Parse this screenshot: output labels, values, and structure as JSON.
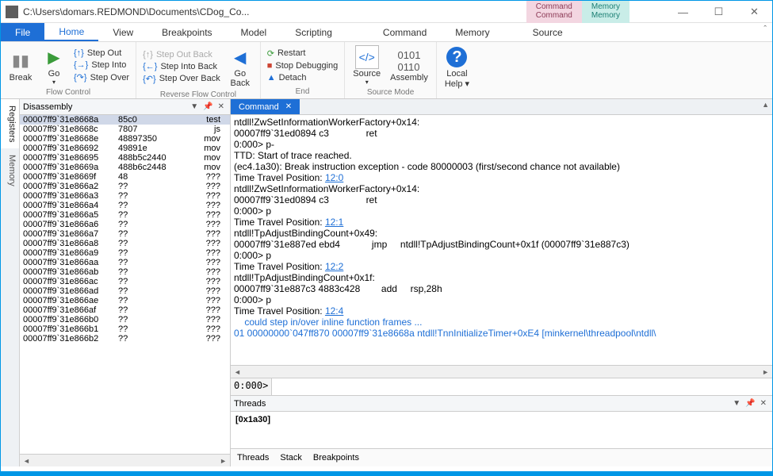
{
  "window": {
    "title": "C:\\Users\\domars.REDMOND\\Documents\\CDog_Co...",
    "top_contextual_tabs": [
      {
        "group": "Command",
        "item": "Command",
        "cls": "pink"
      },
      {
        "group": "Memory",
        "item": "Memory",
        "cls": "teal"
      }
    ]
  },
  "menu": {
    "file": "File",
    "items": [
      "Home",
      "View",
      "Breakpoints",
      "Model",
      "Scripting",
      "Command",
      "Memory",
      "Source"
    ],
    "active_index": 0
  },
  "ribbon": {
    "flow": {
      "break": "Break",
      "go": "Go",
      "step_out": "Step Out",
      "step_into": "Step Into",
      "step_over": "Step Over",
      "group": "Flow Control"
    },
    "reverse": {
      "step_out_back": "Step Out Back",
      "step_into_back": "Step Into Back",
      "step_over_back": "Step Over Back",
      "go_back": "Go\nBack",
      "group": "Reverse Flow Control"
    },
    "end": {
      "restart": "Restart",
      "stop": "Stop Debugging",
      "detach": "Detach",
      "group": "End"
    },
    "srcmode": {
      "source": "Source",
      "assembly": "Assembly",
      "group": "Source Mode"
    },
    "help": {
      "label": "Local\nHelp ▾"
    }
  },
  "side_tabs": [
    "Registers",
    "Memory"
  ],
  "panel_title": "Disassembly",
  "disasm_rows": [
    {
      "addr": "00007ff9`31e8668a",
      "bytes": "85c0",
      "mn": "test",
      "sel": true
    },
    {
      "addr": "00007ff9`31e8668c",
      "bytes": "7807",
      "mn": "js"
    },
    {
      "addr": "00007ff9`31e8668e",
      "bytes": "48897350",
      "mn": "mov"
    },
    {
      "addr": "00007ff9`31e86692",
      "bytes": "49891e",
      "mn": "mov"
    },
    {
      "addr": "00007ff9`31e86695",
      "bytes": "488b5c2440",
      "mn": "mov"
    },
    {
      "addr": "00007ff9`31e8669a",
      "bytes": "488b6c2448",
      "mn": "mov"
    },
    {
      "addr": "00007ff9`31e8669f",
      "bytes": "48",
      "mn": "???"
    },
    {
      "addr": "00007ff9`31e866a2",
      "bytes": "??",
      "mn": "???"
    },
    {
      "addr": "00007ff9`31e866a3",
      "bytes": "??",
      "mn": "???"
    },
    {
      "addr": "00007ff9`31e866a4",
      "bytes": "??",
      "mn": "???"
    },
    {
      "addr": "00007ff9`31e866a5",
      "bytes": "??",
      "mn": "???"
    },
    {
      "addr": "00007ff9`31e866a6",
      "bytes": "??",
      "mn": "???"
    },
    {
      "addr": "00007ff9`31e866a7",
      "bytes": "??",
      "mn": "???"
    },
    {
      "addr": "00007ff9`31e866a8",
      "bytes": "??",
      "mn": "???"
    },
    {
      "addr": "00007ff9`31e866a9",
      "bytes": "??",
      "mn": "???"
    },
    {
      "addr": "00007ff9`31e866aa",
      "bytes": "??",
      "mn": "???"
    },
    {
      "addr": "00007ff9`31e866ab",
      "bytes": "??",
      "mn": "???"
    },
    {
      "addr": "00007ff9`31e866ac",
      "bytes": "??",
      "mn": "???"
    },
    {
      "addr": "00007ff9`31e866ad",
      "bytes": "??",
      "mn": "???"
    },
    {
      "addr": "00007ff9`31e866ae",
      "bytes": "??",
      "mn": "???"
    },
    {
      "addr": "00007ff9`31e866af",
      "bytes": "??",
      "mn": "???"
    },
    {
      "addr": "00007ff9`31e866b0",
      "bytes": "??",
      "mn": "???"
    },
    {
      "addr": "00007ff9`31e866b1",
      "bytes": "??",
      "mn": "???"
    },
    {
      "addr": "00007ff9`31e866b2",
      "bytes": "??",
      "mn": "???"
    }
  ],
  "command": {
    "tab": "Command",
    "lines_pre": "ntdll!ZwSetInformationWorkerFactory+0x14:\n00007ff9`31ed0894 c3              ret\n0:000> p-\nTTD: Start of trace reached.\n(ec4.1a30): Break instruction exception - code 80000003 (first/second chance not available)\nTime Travel Position: ",
    "link1": "12:0",
    "lines_mid1": "\nntdll!ZwSetInformationWorkerFactory+0x14:\n00007ff9`31ed0894 c3              ret\n0:000> p\nTime Travel Position: ",
    "link2": "12:1",
    "lines_mid2": "\nntdll!TpAdjustBindingCount+0x49:\n00007ff9`31e887ed ebd4            jmp     ntdll!TpAdjustBindingCount+0x1f (00007ff9`31e887c3)\n0:000> p\nTime Travel Position: ",
    "link3": "12:2",
    "lines_mid3": "\nntdll!TpAdjustBindingCount+0x1f:\n00007ff9`31e887c3 4883c428        add     rsp,28h\n0:000> p\nTime Travel Position: ",
    "link4": "12:4",
    "lines_post": "\n    could step in/over inline function frames ...\n01 00000000`047ff870 00007ff9`31e8668a ntdll!TnnInitializeTimer+0xE4 [minkernel\\threadpool\\ntdll\\",
    "prompt": "0:000>"
  },
  "threads": {
    "title": "Threads",
    "item": "[0x1a30]",
    "tabs": [
      "Threads",
      "Stack",
      "Breakpoints"
    ]
  }
}
